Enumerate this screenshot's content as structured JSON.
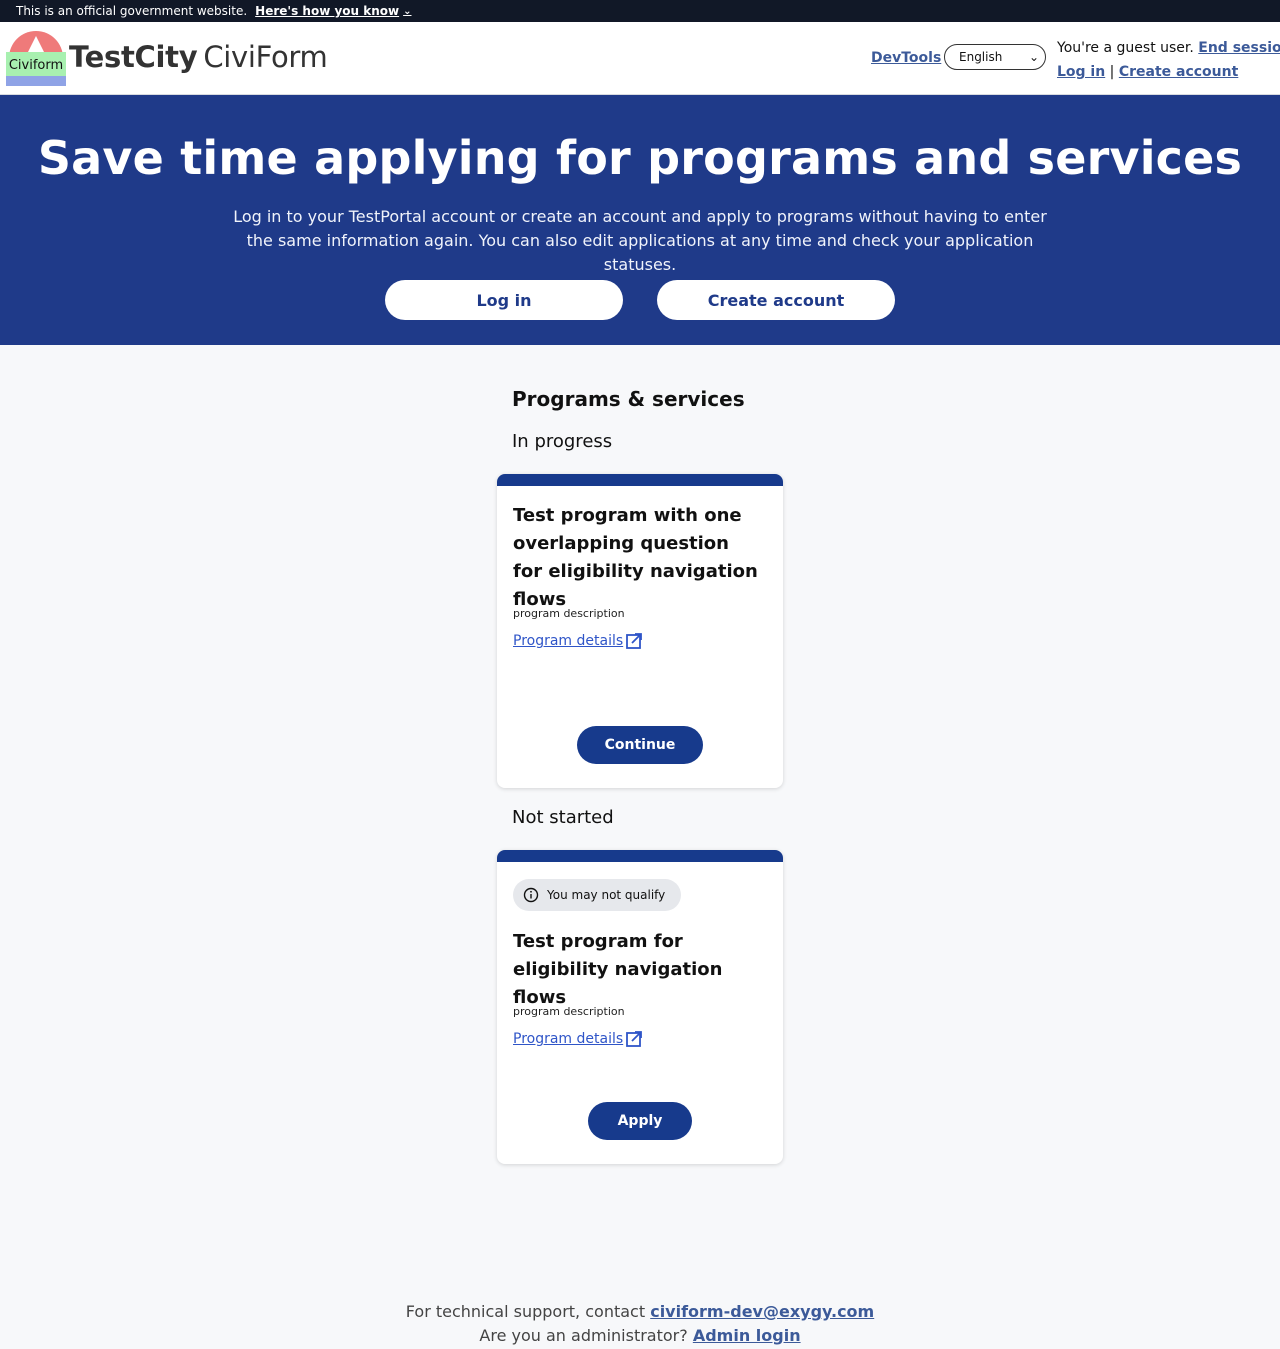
{
  "gov_banner": {
    "text": "This is an official government website.",
    "link": "Here's how you know"
  },
  "header": {
    "logo_text": "Civiform",
    "brand_city": "TestCity",
    "brand_product": "CiviForm",
    "devtools": "DevTools",
    "language": "English",
    "guest_text": "You're a guest user.",
    "end_session": "End session",
    "login": "Log in",
    "separator": "|",
    "create_account": "Create account"
  },
  "hero": {
    "title": "Save time applying for programs and services",
    "description": "Log in to your TestPortal account or create an account and apply to programs without having to enter the same information again. You can also edit applications at any time and check your application statuses.",
    "login_button": "Log in",
    "create_button": "Create account"
  },
  "main": {
    "section_title": "Programs & services",
    "groups": [
      {
        "title": "In progress",
        "card": {
          "title": "Test program with one overlapping question for eligibility navigation flows",
          "description": "program description",
          "details_link": "Program details",
          "action": "Continue"
        }
      },
      {
        "title": "Not started",
        "card": {
          "badge": "You may not qualify",
          "title": "Test program for eligibility navigation flows",
          "description": "program description",
          "details_link": "Program details",
          "action": "Apply"
        }
      }
    ]
  },
  "footer": {
    "support_text": "For technical support, contact",
    "support_email": "civiform-dev@exygy.com",
    "admin_text": "Are you an administrator?",
    "admin_link": "Admin login"
  },
  "colors": {
    "primary": "#1f3a89",
    "link": "#3c5a99",
    "background": "#f7f8fa"
  }
}
